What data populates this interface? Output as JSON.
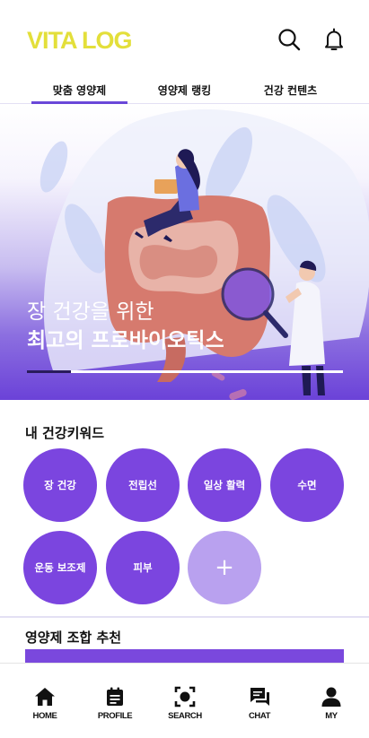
{
  "header": {
    "logo": "VITA LOG",
    "icons": [
      "search-icon",
      "bell-icon"
    ]
  },
  "tabs": [
    {
      "label": "맞춤 영양제",
      "active": true
    },
    {
      "label": "영양제 랭킹",
      "active": false
    },
    {
      "label": "건강 컨텐츠",
      "active": false
    }
  ],
  "hero": {
    "line1": "장 건강을 위한",
    "line2": "최고의 프로바이오틱스",
    "progress": 0.14
  },
  "keywords": {
    "title": "내 건강키워드",
    "items": [
      "장 건강",
      "전립선",
      "일상 활력",
      "수면",
      "운동 보조제",
      "피부"
    ],
    "add_label": "+"
  },
  "combo": {
    "title": "영양제 조합 추천"
  },
  "bottom_nav": [
    {
      "label": "HOME",
      "icon": "home-icon"
    },
    {
      "label": "PROFILE",
      "icon": "profile-icon"
    },
    {
      "label": "SEARCH",
      "icon": "scan-icon"
    },
    {
      "label": "CHAT",
      "icon": "chat-icon"
    },
    {
      "label": "MY",
      "icon": "user-icon"
    }
  ],
  "colors": {
    "accent": "#7b45df",
    "logo": "#e3df3a",
    "add_bubble": "#b9a1ef"
  }
}
